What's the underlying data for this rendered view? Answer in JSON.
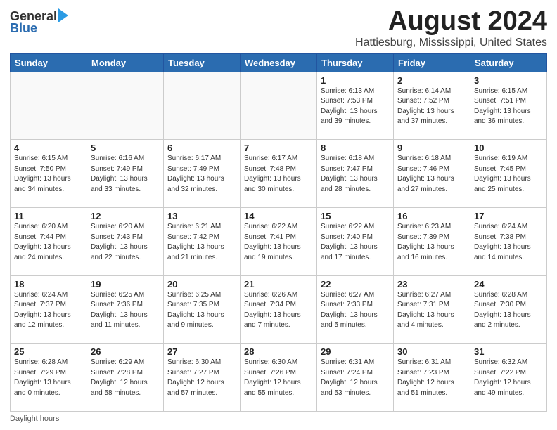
{
  "logo": {
    "general": "General",
    "blue": "Blue"
  },
  "title": "August 2024",
  "subtitle": "Hattiesburg, Mississippi, United States",
  "days_of_week": [
    "Sunday",
    "Monday",
    "Tuesday",
    "Wednesday",
    "Thursday",
    "Friday",
    "Saturday"
  ],
  "footer_label": "Daylight hours",
  "weeks": [
    [
      {
        "day": "",
        "info": ""
      },
      {
        "day": "",
        "info": ""
      },
      {
        "day": "",
        "info": ""
      },
      {
        "day": "",
        "info": ""
      },
      {
        "day": "1",
        "info": "Sunrise: 6:13 AM\nSunset: 7:53 PM\nDaylight: 13 hours\nand 39 minutes."
      },
      {
        "day": "2",
        "info": "Sunrise: 6:14 AM\nSunset: 7:52 PM\nDaylight: 13 hours\nand 37 minutes."
      },
      {
        "day": "3",
        "info": "Sunrise: 6:15 AM\nSunset: 7:51 PM\nDaylight: 13 hours\nand 36 minutes."
      }
    ],
    [
      {
        "day": "4",
        "info": "Sunrise: 6:15 AM\nSunset: 7:50 PM\nDaylight: 13 hours\nand 34 minutes."
      },
      {
        "day": "5",
        "info": "Sunrise: 6:16 AM\nSunset: 7:49 PM\nDaylight: 13 hours\nand 33 minutes."
      },
      {
        "day": "6",
        "info": "Sunrise: 6:17 AM\nSunset: 7:49 PM\nDaylight: 13 hours\nand 32 minutes."
      },
      {
        "day": "7",
        "info": "Sunrise: 6:17 AM\nSunset: 7:48 PM\nDaylight: 13 hours\nand 30 minutes."
      },
      {
        "day": "8",
        "info": "Sunrise: 6:18 AM\nSunset: 7:47 PM\nDaylight: 13 hours\nand 28 minutes."
      },
      {
        "day": "9",
        "info": "Sunrise: 6:18 AM\nSunset: 7:46 PM\nDaylight: 13 hours\nand 27 minutes."
      },
      {
        "day": "10",
        "info": "Sunrise: 6:19 AM\nSunset: 7:45 PM\nDaylight: 13 hours\nand 25 minutes."
      }
    ],
    [
      {
        "day": "11",
        "info": "Sunrise: 6:20 AM\nSunset: 7:44 PM\nDaylight: 13 hours\nand 24 minutes."
      },
      {
        "day": "12",
        "info": "Sunrise: 6:20 AM\nSunset: 7:43 PM\nDaylight: 13 hours\nand 22 minutes."
      },
      {
        "day": "13",
        "info": "Sunrise: 6:21 AM\nSunset: 7:42 PM\nDaylight: 13 hours\nand 21 minutes."
      },
      {
        "day": "14",
        "info": "Sunrise: 6:22 AM\nSunset: 7:41 PM\nDaylight: 13 hours\nand 19 minutes."
      },
      {
        "day": "15",
        "info": "Sunrise: 6:22 AM\nSunset: 7:40 PM\nDaylight: 13 hours\nand 17 minutes."
      },
      {
        "day": "16",
        "info": "Sunrise: 6:23 AM\nSunset: 7:39 PM\nDaylight: 13 hours\nand 16 minutes."
      },
      {
        "day": "17",
        "info": "Sunrise: 6:24 AM\nSunset: 7:38 PM\nDaylight: 13 hours\nand 14 minutes."
      }
    ],
    [
      {
        "day": "18",
        "info": "Sunrise: 6:24 AM\nSunset: 7:37 PM\nDaylight: 13 hours\nand 12 minutes."
      },
      {
        "day": "19",
        "info": "Sunrise: 6:25 AM\nSunset: 7:36 PM\nDaylight: 13 hours\nand 11 minutes."
      },
      {
        "day": "20",
        "info": "Sunrise: 6:25 AM\nSunset: 7:35 PM\nDaylight: 13 hours\nand 9 minutes."
      },
      {
        "day": "21",
        "info": "Sunrise: 6:26 AM\nSunset: 7:34 PM\nDaylight: 13 hours\nand 7 minutes."
      },
      {
        "day": "22",
        "info": "Sunrise: 6:27 AM\nSunset: 7:33 PM\nDaylight: 13 hours\nand 5 minutes."
      },
      {
        "day": "23",
        "info": "Sunrise: 6:27 AM\nSunset: 7:31 PM\nDaylight: 13 hours\nand 4 minutes."
      },
      {
        "day": "24",
        "info": "Sunrise: 6:28 AM\nSunset: 7:30 PM\nDaylight: 13 hours\nand 2 minutes."
      }
    ],
    [
      {
        "day": "25",
        "info": "Sunrise: 6:28 AM\nSunset: 7:29 PM\nDaylight: 13 hours\nand 0 minutes."
      },
      {
        "day": "26",
        "info": "Sunrise: 6:29 AM\nSunset: 7:28 PM\nDaylight: 12 hours\nand 58 minutes."
      },
      {
        "day": "27",
        "info": "Sunrise: 6:30 AM\nSunset: 7:27 PM\nDaylight: 12 hours\nand 57 minutes."
      },
      {
        "day": "28",
        "info": "Sunrise: 6:30 AM\nSunset: 7:26 PM\nDaylight: 12 hours\nand 55 minutes."
      },
      {
        "day": "29",
        "info": "Sunrise: 6:31 AM\nSunset: 7:24 PM\nDaylight: 12 hours\nand 53 minutes."
      },
      {
        "day": "30",
        "info": "Sunrise: 6:31 AM\nSunset: 7:23 PM\nDaylight: 12 hours\nand 51 minutes."
      },
      {
        "day": "31",
        "info": "Sunrise: 6:32 AM\nSunset: 7:22 PM\nDaylight: 12 hours\nand 49 minutes."
      }
    ]
  ]
}
